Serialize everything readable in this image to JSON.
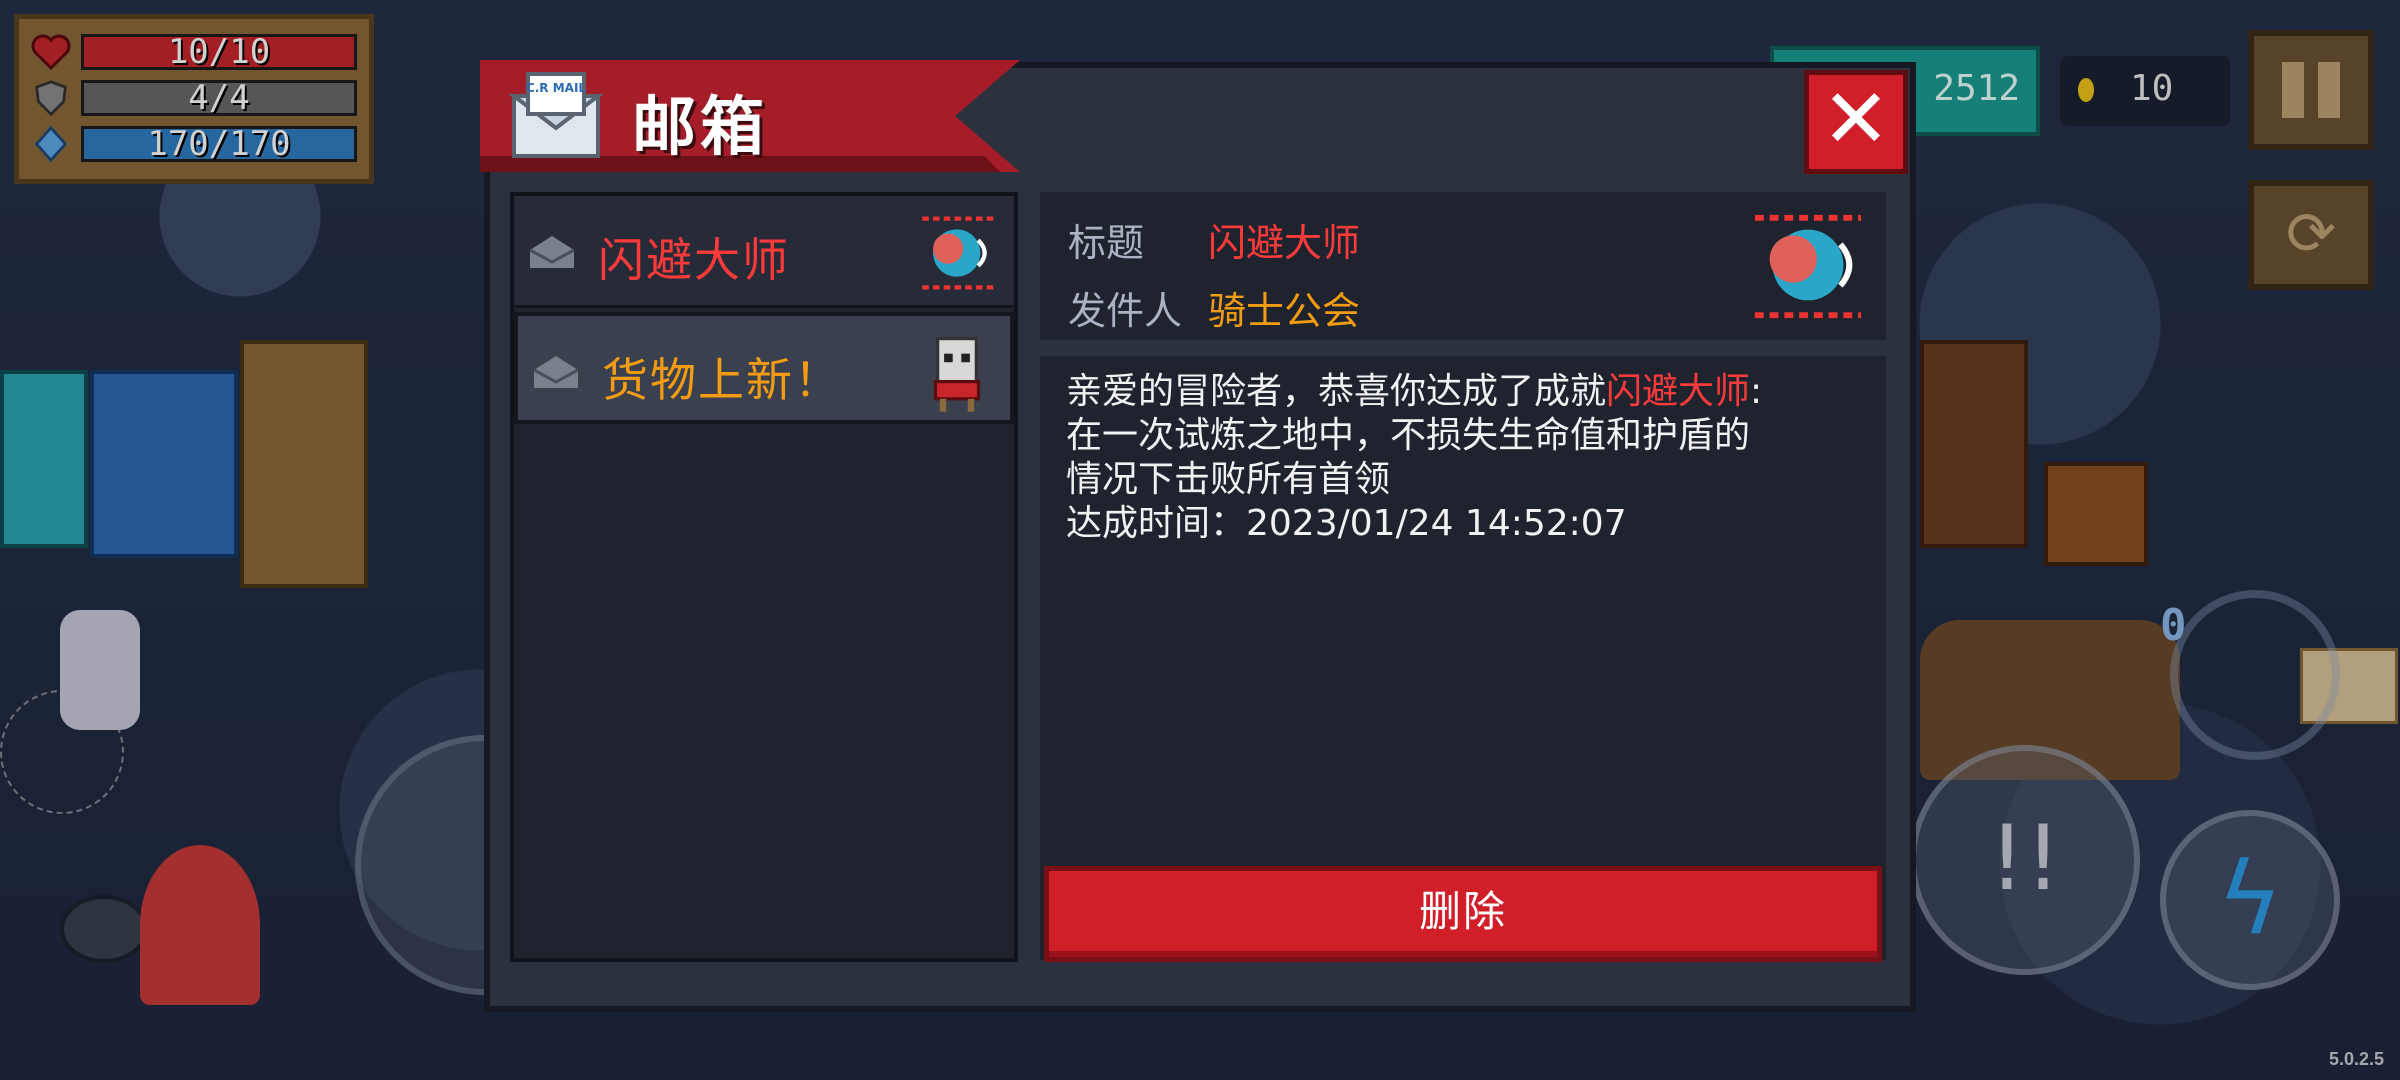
{
  "hud": {
    "health": {
      "text": "10/10",
      "value": 10,
      "max": 10,
      "color": "#c8262c"
    },
    "armor": {
      "text": "4/4",
      "value": 4,
      "max": 4,
      "color": "#6a6a6a"
    },
    "energy": {
      "text": "170/170",
      "value": 170,
      "max": 170,
      "color": "#2f7ec4"
    },
    "gems": "2512",
    "coins": "10",
    "ammo": "0",
    "version": "5.0.2.5"
  },
  "dialog": {
    "title": "邮箱",
    "mail_icon_text": "C.R MAIL",
    "mails": [
      {
        "label": "闪避大师",
        "color": "#ff3a3a"
      },
      {
        "label": "货物上新！",
        "color": "#f39c12"
      }
    ],
    "detail": {
      "title_label": "标题",
      "title_value": "闪避大师",
      "sender_label": "发件人",
      "sender_value": "骑士公会",
      "body_prefix": "亲爱的冒险者，恭喜你达成了成就",
      "body_highlight": "闪避大师",
      "body_line1_suffix": ":",
      "body_line2": "在一次试炼之地中，不损失生命值和护盾的",
      "body_line3": "情况下击败所有首领",
      "body_line4": "达成时间：2023/01/24 14:52:07"
    },
    "delete_label": "删除"
  },
  "colors": {
    "title_red": "#ff3a3a",
    "sender_orange": "#f39c12",
    "button_red": "#d11f2a"
  }
}
